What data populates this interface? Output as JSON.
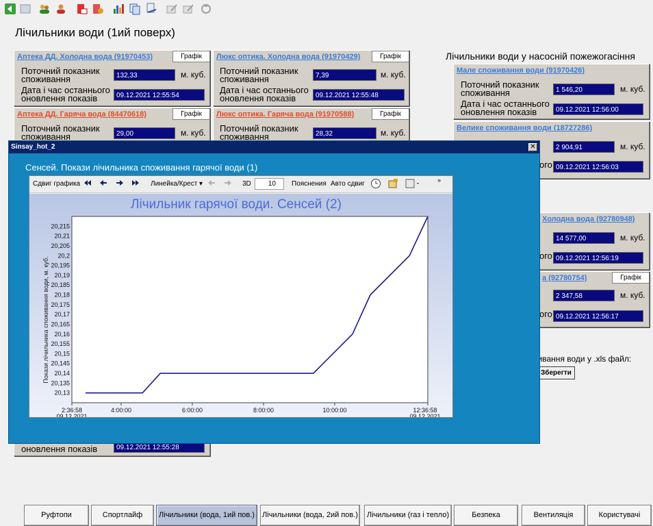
{
  "page_title": "Лічильники води (1ий поверх)",
  "toolbar": {
    "icons": [
      "back-arrow-icon",
      "document-icon",
      "users-icon",
      "user-icon",
      "delete-icon",
      "settings-icon",
      "bar-chart-icon",
      "copy-icon",
      "print-icon",
      "edit-icon",
      "edit-disabled-icon",
      "refresh-icon"
    ]
  },
  "meters": [
    {
      "title": "Аптека ДД. Холодна вода (91970453)",
      "graph": "Графік",
      "consumption_label": "Поточний показник споживання",
      "value": "132,33",
      "unit": "м. куб.",
      "date_label": "Дата і час останнього оновлення показів",
      "date": "09.12.2021 12:55:54"
    },
    {
      "title": "Люкс оптика. Холодна вода (91970429)",
      "graph": "Графік",
      "consumption_label": "Поточний показник споживання",
      "value": "7,39",
      "unit": "м. куб.",
      "date_label": "Дата і час останнього оновлення показів",
      "date": "09.12.2021 12:55:48"
    },
    {
      "title": "Аптека ДД. Гаряча вода (84470618)",
      "graph": "Графік",
      "consumption_label": "Поточний показник споживання",
      "value": "29,00",
      "unit": "м. куб."
    },
    {
      "title": "Люкс оптика. Гаряча вода (91970588)",
      "graph": "Графік",
      "consumption_label": "Поточний показник споживання",
      "value": "28,32",
      "unit": "м. куб."
    }
  ],
  "hidden_meter_date_label": "оновлення показів",
  "hidden_meter_date": "09.12.2021 12:55:28",
  "pump": {
    "title": "Лічильники води у насосній пожежогасіння",
    "meters": [
      {
        "title": "Мале споживання води (91970426)",
        "consumption_label": "Поточний показник споживання",
        "value": "1 546,20",
        "unit": "м. куб.",
        "date_label": "Дата і час останнього оновлення показів",
        "date": "09.12.2021 12:56:00"
      },
      {
        "title": "Велике споживання води (18727286)",
        "value": "2 904,91",
        "unit": "м. куб.",
        "date_tail": "ого",
        "date": "09.12.2021 12:56:03"
      },
      {
        "title": "Холодна вода (92780948)",
        "value": "14 577,00",
        "unit": "м. куб.",
        "date_tail": "ого",
        "date": "09.12.2021 12:56:19"
      },
      {
        "title": "а (92780754)",
        "graph": "Графік",
        "value": "2 347,58",
        "unit": "м. куб.",
        "date_tail": "ого",
        "date": "09.12.2021 12:56:17"
      }
    ],
    "xls_label": "оживання води у .xls файл:",
    "save_label": "Зберегти"
  },
  "popup": {
    "window_title": "Sinsay_hot_2",
    "close": "✕",
    "heading": "Сенсей. Покази лічильника споживання гарячої води (1)",
    "chart_toolbar": {
      "shift": "Сдвиг графика",
      "ruler": "Линейка/Крест",
      "three_d": "3D",
      "depth": "10",
      "notes": "Пояснения",
      "auto": "Авто сдвиг"
    }
  },
  "chart_data": {
    "type": "line",
    "title": "Лічильник гарячої води. Сенсей (2)",
    "ylabel": "Покази лічильника споживання води, м. куб.",
    "ylim": [
      20.125,
      20.22
    ],
    "yticks": [
      "20,13",
      "20,135",
      "20,14",
      "20,145",
      "20,15",
      "20,155",
      "20,16",
      "20,165",
      "20,17",
      "20,175",
      "20,18",
      "20,185",
      "20,19",
      "20,195",
      "20,2",
      "20,205",
      "20,21",
      "20,215"
    ],
    "xticks": [
      {
        "label": "2:36:58",
        "sub": "09.12.2021",
        "hour": 2.616
      },
      {
        "label": "4:00:00",
        "sub": "",
        "hour": 4.0
      },
      {
        "label": "6:00:00",
        "sub": "",
        "hour": 6.0
      },
      {
        "label": "8:00:00",
        "sub": "",
        "hour": 8.0
      },
      {
        "label": "10:00:00",
        "sub": "",
        "hour": 10.0
      },
      {
        "label": "12:36:58",
        "sub": "09.12.2021",
        "hour": 12.616
      }
    ],
    "xlim": [
      2.616,
      12.616
    ],
    "series": [
      {
        "color": "#1a1a8c",
        "points": [
          [
            3.0,
            20.13
          ],
          [
            4.6,
            20.13
          ],
          [
            5.1,
            20.14
          ],
          [
            9.4,
            20.14
          ],
          [
            10.5,
            20.16
          ],
          [
            11.0,
            20.18
          ],
          [
            12.1,
            20.2
          ],
          [
            12.616,
            20.22
          ]
        ]
      }
    ]
  },
  "nav": [
    "Руфтопи",
    "Спортлайф",
    "Лічильники (вода, 1ий пов.)",
    "Лічильники (вода, 2ий пов.)",
    "Лічильники (газ і тепло)",
    "Безпека",
    "Вентиляція",
    "Користувачі"
  ]
}
